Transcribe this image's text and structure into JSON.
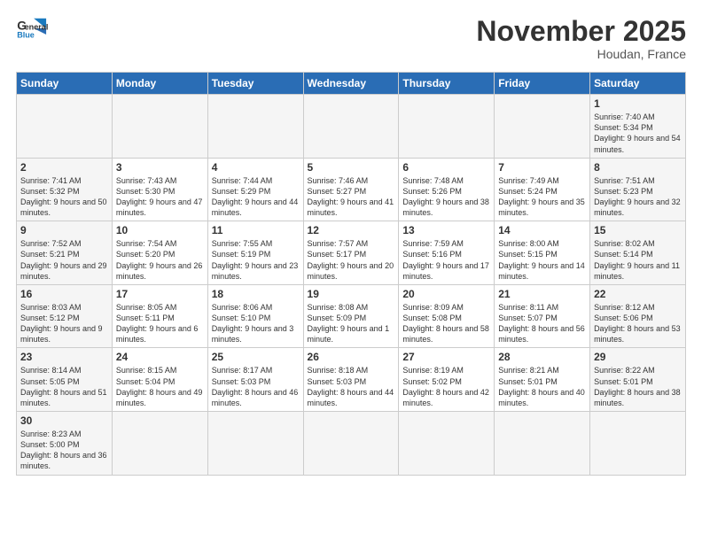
{
  "logo": {
    "line1": "General",
    "line2": "Blue"
  },
  "calendar": {
    "title": "November 2025",
    "subtitle": "Houdan, France",
    "days_of_week": [
      "Sunday",
      "Monday",
      "Tuesday",
      "Wednesday",
      "Thursday",
      "Friday",
      "Saturday"
    ],
    "weeks": [
      [
        {
          "day": "",
          "info": ""
        },
        {
          "day": "",
          "info": ""
        },
        {
          "day": "",
          "info": ""
        },
        {
          "day": "",
          "info": ""
        },
        {
          "day": "",
          "info": ""
        },
        {
          "day": "",
          "info": ""
        },
        {
          "day": "1",
          "info": "Sunrise: 7:40 AM\nSunset: 5:34 PM\nDaylight: 9 hours\nand 54 minutes."
        }
      ],
      [
        {
          "day": "2",
          "info": "Sunrise: 7:41 AM\nSunset: 5:32 PM\nDaylight: 9 hours\nand 50 minutes."
        },
        {
          "day": "3",
          "info": "Sunrise: 7:43 AM\nSunset: 5:30 PM\nDaylight: 9 hours\nand 47 minutes."
        },
        {
          "day": "4",
          "info": "Sunrise: 7:44 AM\nSunset: 5:29 PM\nDaylight: 9 hours\nand 44 minutes."
        },
        {
          "day": "5",
          "info": "Sunrise: 7:46 AM\nSunset: 5:27 PM\nDaylight: 9 hours\nand 41 minutes."
        },
        {
          "day": "6",
          "info": "Sunrise: 7:48 AM\nSunset: 5:26 PM\nDaylight: 9 hours\nand 38 minutes."
        },
        {
          "day": "7",
          "info": "Sunrise: 7:49 AM\nSunset: 5:24 PM\nDaylight: 9 hours\nand 35 minutes."
        },
        {
          "day": "8",
          "info": "Sunrise: 7:51 AM\nSunset: 5:23 PM\nDaylight: 9 hours\nand 32 minutes."
        }
      ],
      [
        {
          "day": "9",
          "info": "Sunrise: 7:52 AM\nSunset: 5:21 PM\nDaylight: 9 hours\nand 29 minutes."
        },
        {
          "day": "10",
          "info": "Sunrise: 7:54 AM\nSunset: 5:20 PM\nDaylight: 9 hours\nand 26 minutes."
        },
        {
          "day": "11",
          "info": "Sunrise: 7:55 AM\nSunset: 5:19 PM\nDaylight: 9 hours\nand 23 minutes."
        },
        {
          "day": "12",
          "info": "Sunrise: 7:57 AM\nSunset: 5:17 PM\nDaylight: 9 hours\nand 20 minutes."
        },
        {
          "day": "13",
          "info": "Sunrise: 7:59 AM\nSunset: 5:16 PM\nDaylight: 9 hours\nand 17 minutes."
        },
        {
          "day": "14",
          "info": "Sunrise: 8:00 AM\nSunset: 5:15 PM\nDaylight: 9 hours\nand 14 minutes."
        },
        {
          "day": "15",
          "info": "Sunrise: 8:02 AM\nSunset: 5:14 PM\nDaylight: 9 hours\nand 11 minutes."
        }
      ],
      [
        {
          "day": "16",
          "info": "Sunrise: 8:03 AM\nSunset: 5:12 PM\nDaylight: 9 hours\nand 9 minutes."
        },
        {
          "day": "17",
          "info": "Sunrise: 8:05 AM\nSunset: 5:11 PM\nDaylight: 9 hours\nand 6 minutes."
        },
        {
          "day": "18",
          "info": "Sunrise: 8:06 AM\nSunset: 5:10 PM\nDaylight: 9 hours\nand 3 minutes."
        },
        {
          "day": "19",
          "info": "Sunrise: 8:08 AM\nSunset: 5:09 PM\nDaylight: 9 hours\nand 1 minute."
        },
        {
          "day": "20",
          "info": "Sunrise: 8:09 AM\nSunset: 5:08 PM\nDaylight: 8 hours\nand 58 minutes."
        },
        {
          "day": "21",
          "info": "Sunrise: 8:11 AM\nSunset: 5:07 PM\nDaylight: 8 hours\nand 56 minutes."
        },
        {
          "day": "22",
          "info": "Sunrise: 8:12 AM\nSunset: 5:06 PM\nDaylight: 8 hours\nand 53 minutes."
        }
      ],
      [
        {
          "day": "23",
          "info": "Sunrise: 8:14 AM\nSunset: 5:05 PM\nDaylight: 8 hours\nand 51 minutes."
        },
        {
          "day": "24",
          "info": "Sunrise: 8:15 AM\nSunset: 5:04 PM\nDaylight: 8 hours\nand 49 minutes."
        },
        {
          "day": "25",
          "info": "Sunrise: 8:17 AM\nSunset: 5:03 PM\nDaylight: 8 hours\nand 46 minutes."
        },
        {
          "day": "26",
          "info": "Sunrise: 8:18 AM\nSunset: 5:03 PM\nDaylight: 8 hours\nand 44 minutes."
        },
        {
          "day": "27",
          "info": "Sunrise: 8:19 AM\nSunset: 5:02 PM\nDaylight: 8 hours\nand 42 minutes."
        },
        {
          "day": "28",
          "info": "Sunrise: 8:21 AM\nSunset: 5:01 PM\nDaylight: 8 hours\nand 40 minutes."
        },
        {
          "day": "29",
          "info": "Sunrise: 8:22 AM\nSunset: 5:01 PM\nDaylight: 8 hours\nand 38 minutes."
        }
      ],
      [
        {
          "day": "30",
          "info": "Sunrise: 8:23 AM\nSunset: 5:00 PM\nDaylight: 8 hours\nand 36 minutes."
        },
        {
          "day": "",
          "info": ""
        },
        {
          "day": "",
          "info": ""
        },
        {
          "day": "",
          "info": ""
        },
        {
          "day": "",
          "info": ""
        },
        {
          "day": "",
          "info": ""
        },
        {
          "day": "",
          "info": ""
        }
      ]
    ]
  }
}
